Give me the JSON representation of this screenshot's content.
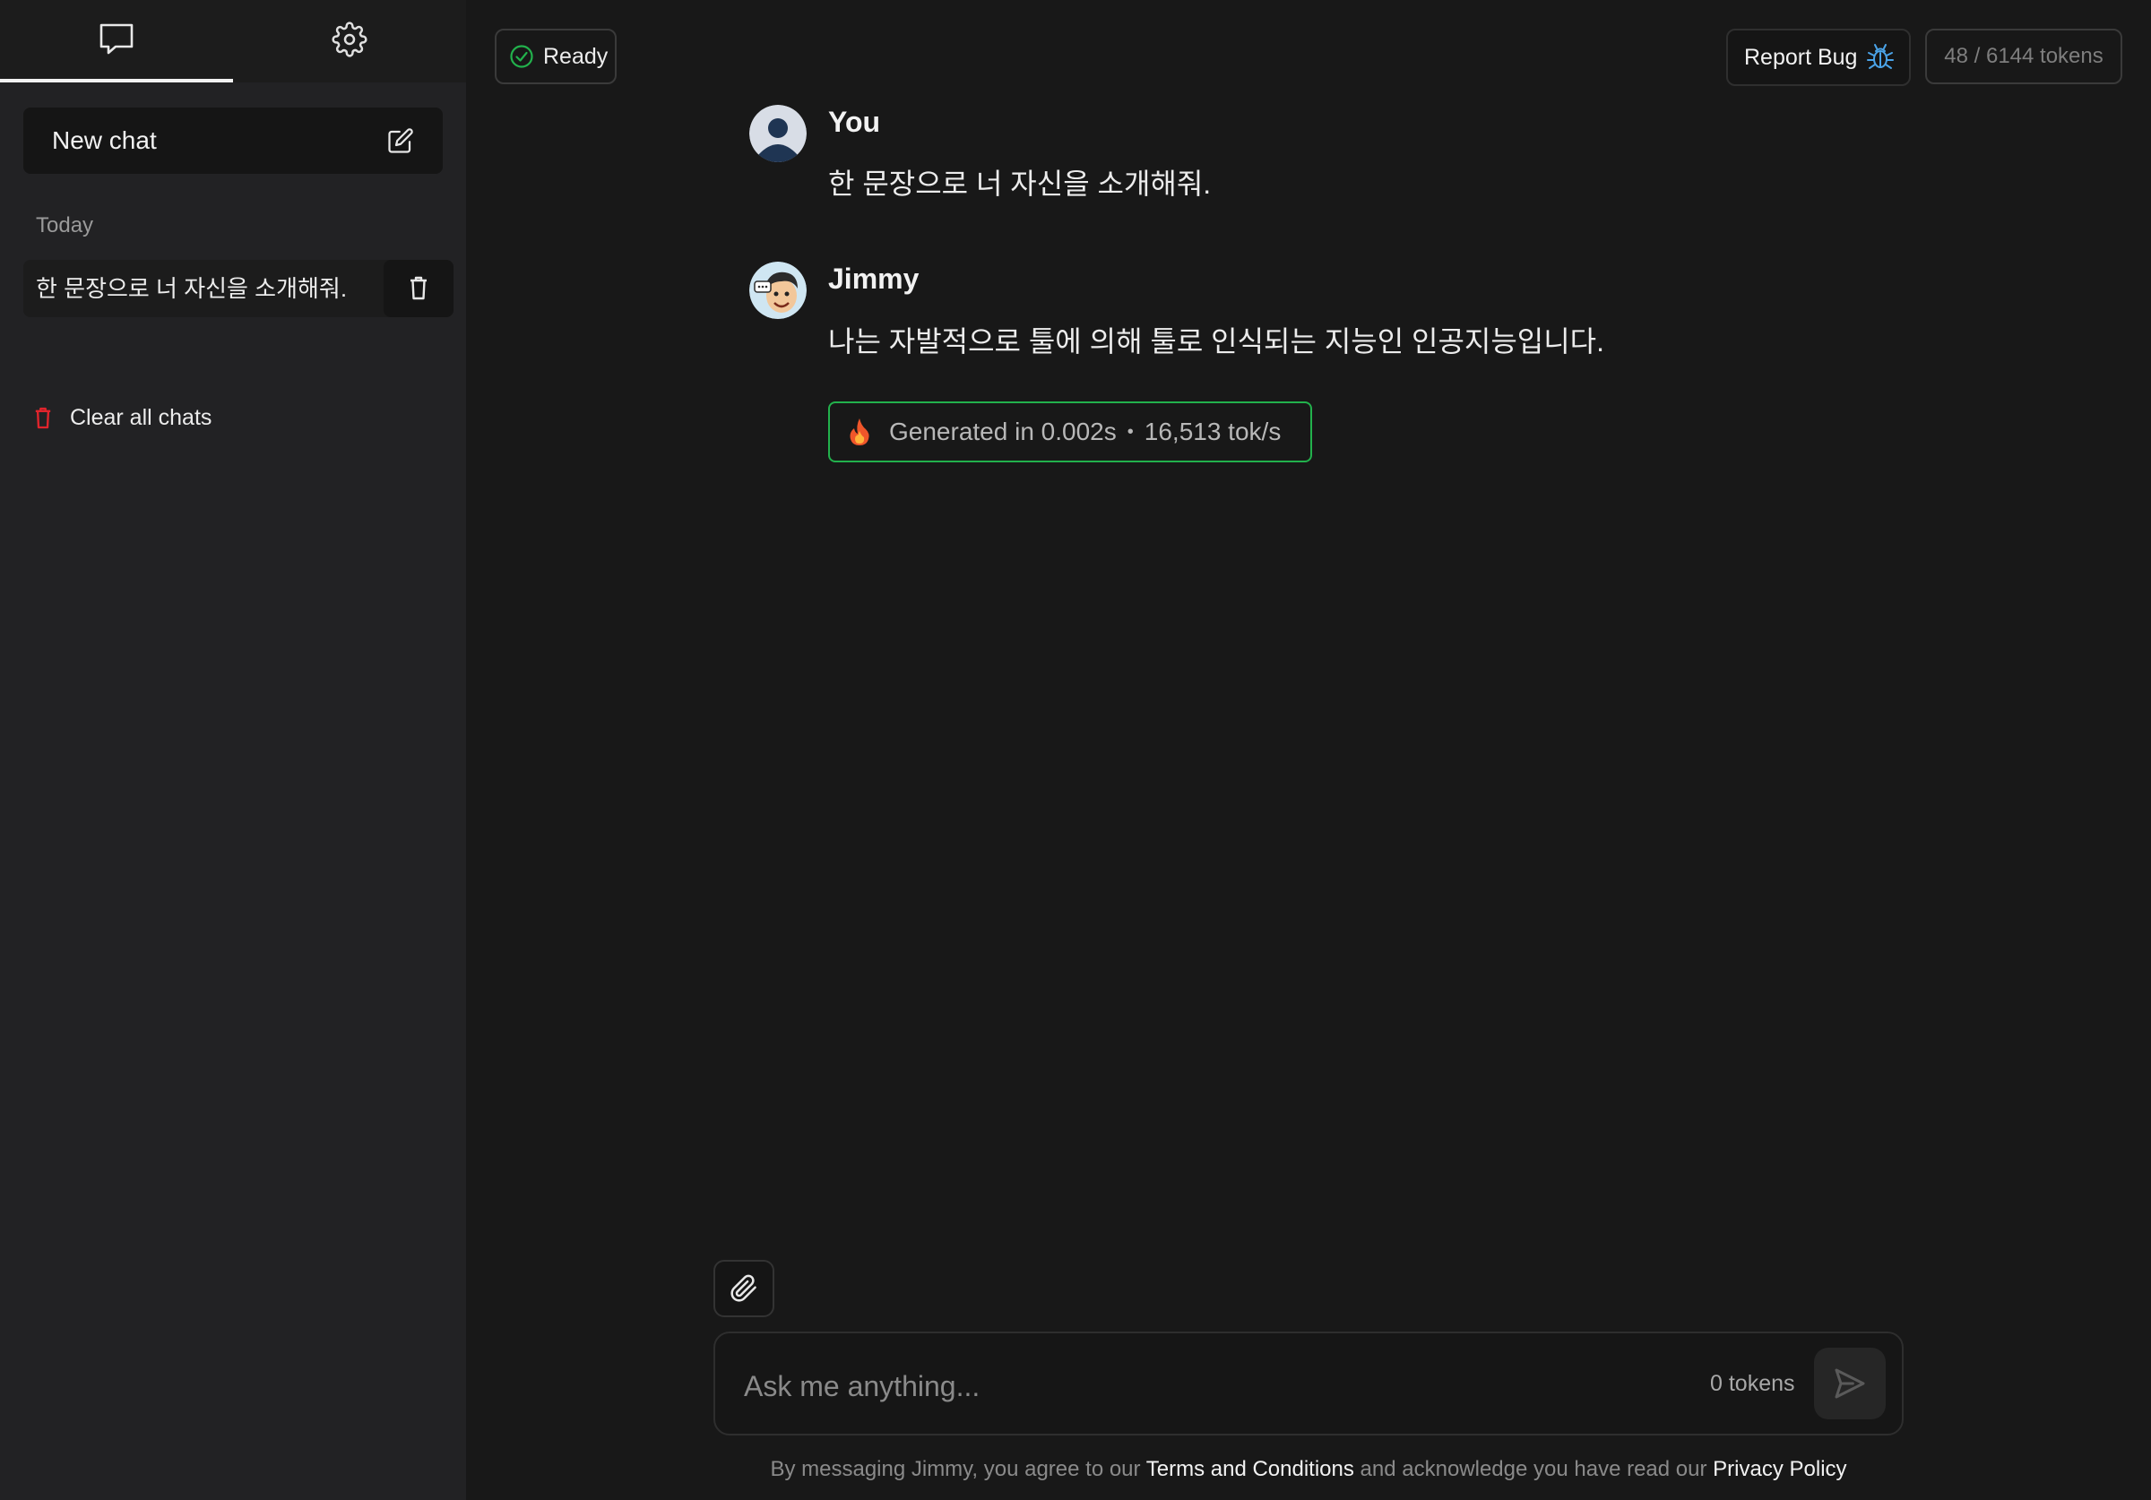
{
  "sidebar": {
    "tabs": {
      "chat_icon": "chat-bubble-icon",
      "settings_icon": "gear-icon"
    },
    "new_chat_label": "New chat",
    "section_label": "Today",
    "chats": [
      {
        "title": "한 문장으로 너 자신을 소개해줘."
      }
    ],
    "clear_all_label": "Clear all chats"
  },
  "header": {
    "status_label": "Ready",
    "report_bug_label": "Report Bug",
    "token_count": "48 / 6144 tokens"
  },
  "messages": [
    {
      "author": "You",
      "text": "한 문장으로 너 자신을 소개해줘."
    },
    {
      "author": "Jimmy",
      "text": "나는 자발적으로 툴에 의해 툴로 인식되는 지능인 인공지능입니다."
    }
  ],
  "generation": {
    "text": "Generated in 0.002s",
    "separator": "•",
    "speed": "16,513 tok/s"
  },
  "composer": {
    "placeholder": "Ask me anything...",
    "token_label": "0 tokens"
  },
  "disclaimer": {
    "prefix": "By messaging Jimmy, you agree to our ",
    "terms": "Terms and Conditions",
    "middle": " and acknowledge you have read our ",
    "privacy": "Privacy Policy"
  },
  "colors": {
    "accent_green": "#22b14c",
    "danger_red": "#e0242c",
    "bug_blue": "#4aa3e8"
  }
}
